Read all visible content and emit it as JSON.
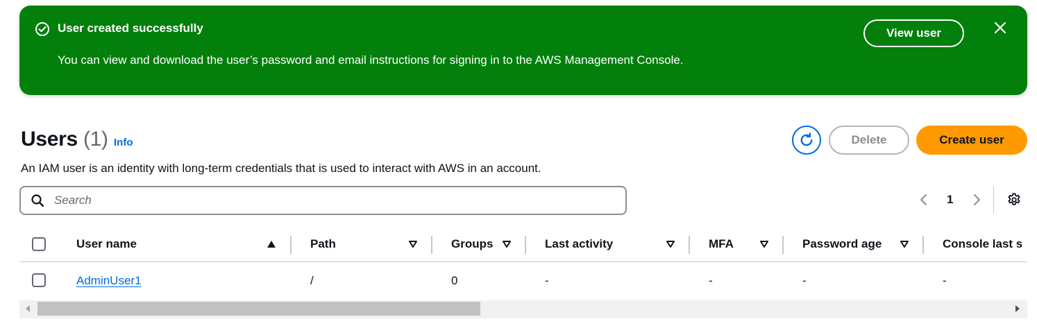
{
  "flash": {
    "title": "User created successfully",
    "message": "You can view and download the user’s password and email instructions for signing in to the AWS Management Console.",
    "action_label": "View user",
    "color": "#037f0c"
  },
  "header": {
    "title": "Users",
    "count": "(1)",
    "info_label": "Info",
    "subtitle": "An IAM user is an identity with long-term credentials that is used to interact with AWS in an account.",
    "delete_label": "Delete",
    "create_label": "Create user",
    "accent_color": "#ff9900"
  },
  "search": {
    "placeholder": "Search",
    "value": ""
  },
  "pagination": {
    "current_page": "1"
  },
  "table": {
    "columns": [
      "User name",
      "Path",
      "Groups",
      "Last activity",
      "MFA",
      "Password age",
      "Console last s"
    ],
    "rows": [
      {
        "user_name": "AdminUser1",
        "path": "/",
        "groups": "0",
        "last_activity": "-",
        "mfa": "-",
        "password_age": "-",
        "console_last_sign_in": "-"
      }
    ]
  },
  "icons": {
    "flash": "check-circle-icon",
    "close": "close-icon",
    "refresh": "refresh-icon",
    "search": "search-icon",
    "settings": "gear-icon"
  }
}
